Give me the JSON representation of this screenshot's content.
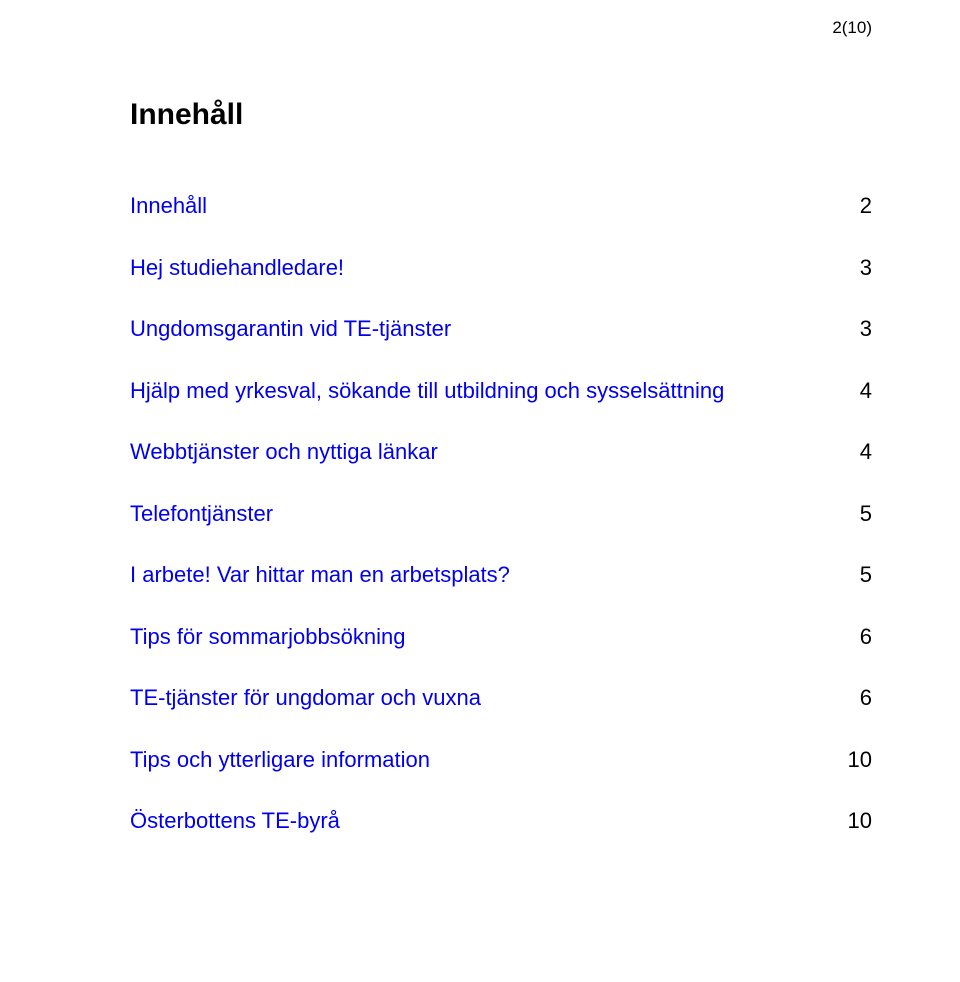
{
  "page_number_label": "2(10)",
  "heading": "Innehåll",
  "toc": [
    {
      "label": "Innehåll",
      "page": "2",
      "link": true
    },
    {
      "label": "Hej studiehandledare!",
      "page": "3",
      "link": true
    },
    {
      "label": "Ungdomsgarantin vid TE-tjänster",
      "page": "3",
      "link": true
    },
    {
      "label": "Hjälp med yrkesval, sökande till utbildning och sysselsättning",
      "page": "4",
      "link": true
    },
    {
      "label": "Webbtjänster och nyttiga länkar",
      "page": "4",
      "link": true
    },
    {
      "label": "Telefontjänster",
      "page": "5",
      "link": true
    },
    {
      "label": "I arbete! Var hittar man en arbetsplats?",
      "page": "5",
      "link": true
    },
    {
      "label": "Tips för sommarjobbsökning",
      "page": "6",
      "link": true
    },
    {
      "label": "TE-tjänster för ungdomar och vuxna",
      "page": "6",
      "link": true
    },
    {
      "label": "Tips och ytterligare information",
      "page": "10",
      "link": true
    },
    {
      "label": "Österbottens TE-byrå",
      "page": "10",
      "link": true
    }
  ]
}
